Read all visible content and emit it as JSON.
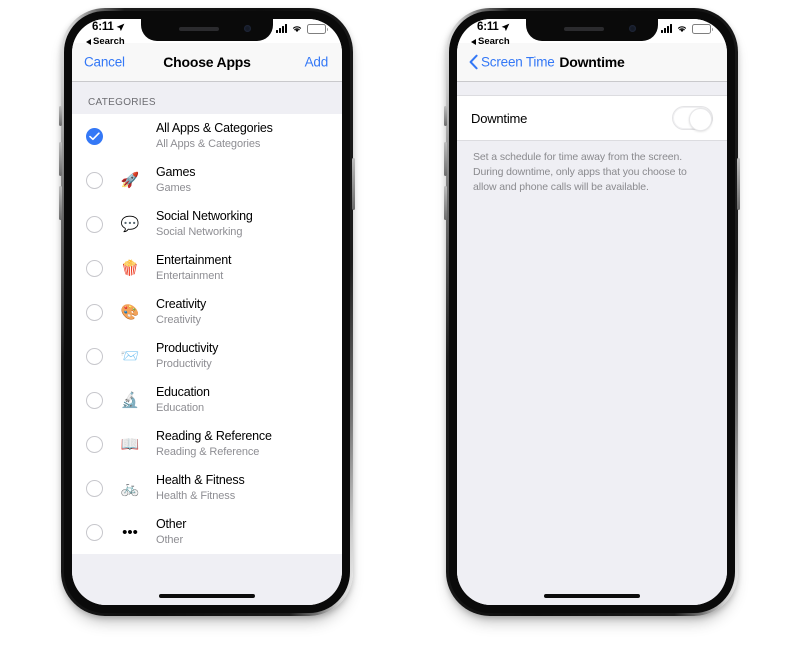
{
  "phones": [
    {
      "id": "choose-apps",
      "status_bar": {
        "time": "6:11",
        "back_chip": "Search",
        "location_icon": "location-arrow-icon",
        "signal_icon": "cellular-signal-icon",
        "wifi_icon": "wifi-icon",
        "battery_icon": "battery-icon"
      },
      "navbar": {
        "left_label": "Cancel",
        "title": "Choose Apps",
        "right_label": "Add"
      },
      "section_header": "CATEGORIES",
      "rows": [
        {
          "title": "All Apps & Categories",
          "subtitle": "All Apps & Categories",
          "emoji": "",
          "icon_name": "no-icon",
          "selected": true
        },
        {
          "title": "Games",
          "subtitle": "Games",
          "emoji": "🚀",
          "icon_name": "rocket-icon",
          "selected": false
        },
        {
          "title": "Social Networking",
          "subtitle": "Social Networking",
          "emoji": "💬",
          "icon_name": "speech-balloon-heart-icon",
          "selected": false
        },
        {
          "title": "Entertainment",
          "subtitle": "Entertainment",
          "emoji": "🍿",
          "icon_name": "popcorn-icon",
          "selected": false
        },
        {
          "title": "Creativity",
          "subtitle": "Creativity",
          "emoji": "🎨",
          "icon_name": "artist-palette-icon",
          "selected": false
        },
        {
          "title": "Productivity",
          "subtitle": "Productivity",
          "emoji": "📨",
          "icon_name": "paper-plane-icon",
          "selected": false
        },
        {
          "title": "Education",
          "subtitle": "Education",
          "emoji": "🔬",
          "icon_name": "atom-icon",
          "selected": false
        },
        {
          "title": "Reading & Reference",
          "subtitle": "Reading & Reference",
          "emoji": "📖",
          "icon_name": "open-book-icon",
          "selected": false
        },
        {
          "title": "Health & Fitness",
          "subtitle": "Health & Fitness",
          "emoji": "🚲",
          "icon_name": "bicycle-icon",
          "selected": false
        },
        {
          "title": "Other",
          "subtitle": "Other",
          "emoji": "•••",
          "icon_name": "ellipsis-icon",
          "selected": false
        }
      ]
    },
    {
      "id": "downtime",
      "status_bar": {
        "time": "6:11",
        "back_chip": "Search",
        "location_icon": "location-arrow-icon",
        "signal_icon": "cellular-signal-icon",
        "wifi_icon": "wifi-icon",
        "battery_icon": "battery-icon"
      },
      "navbar": {
        "left_label": "Screen Time",
        "title": "Downtime",
        "right_label": ""
      },
      "toggle": {
        "label": "Downtime",
        "state": "off"
      },
      "footnote": "Set a schedule for time away from the screen. During downtime, only apps that you choose to allow and phone calls will be available."
    }
  ],
  "colors": {
    "accent_blue": "#3478f6",
    "group_background": "#efeff4",
    "navbar_background": "#f8f8f8",
    "separator": "#dcdce0",
    "secondary_text": "#8e8e93"
  }
}
